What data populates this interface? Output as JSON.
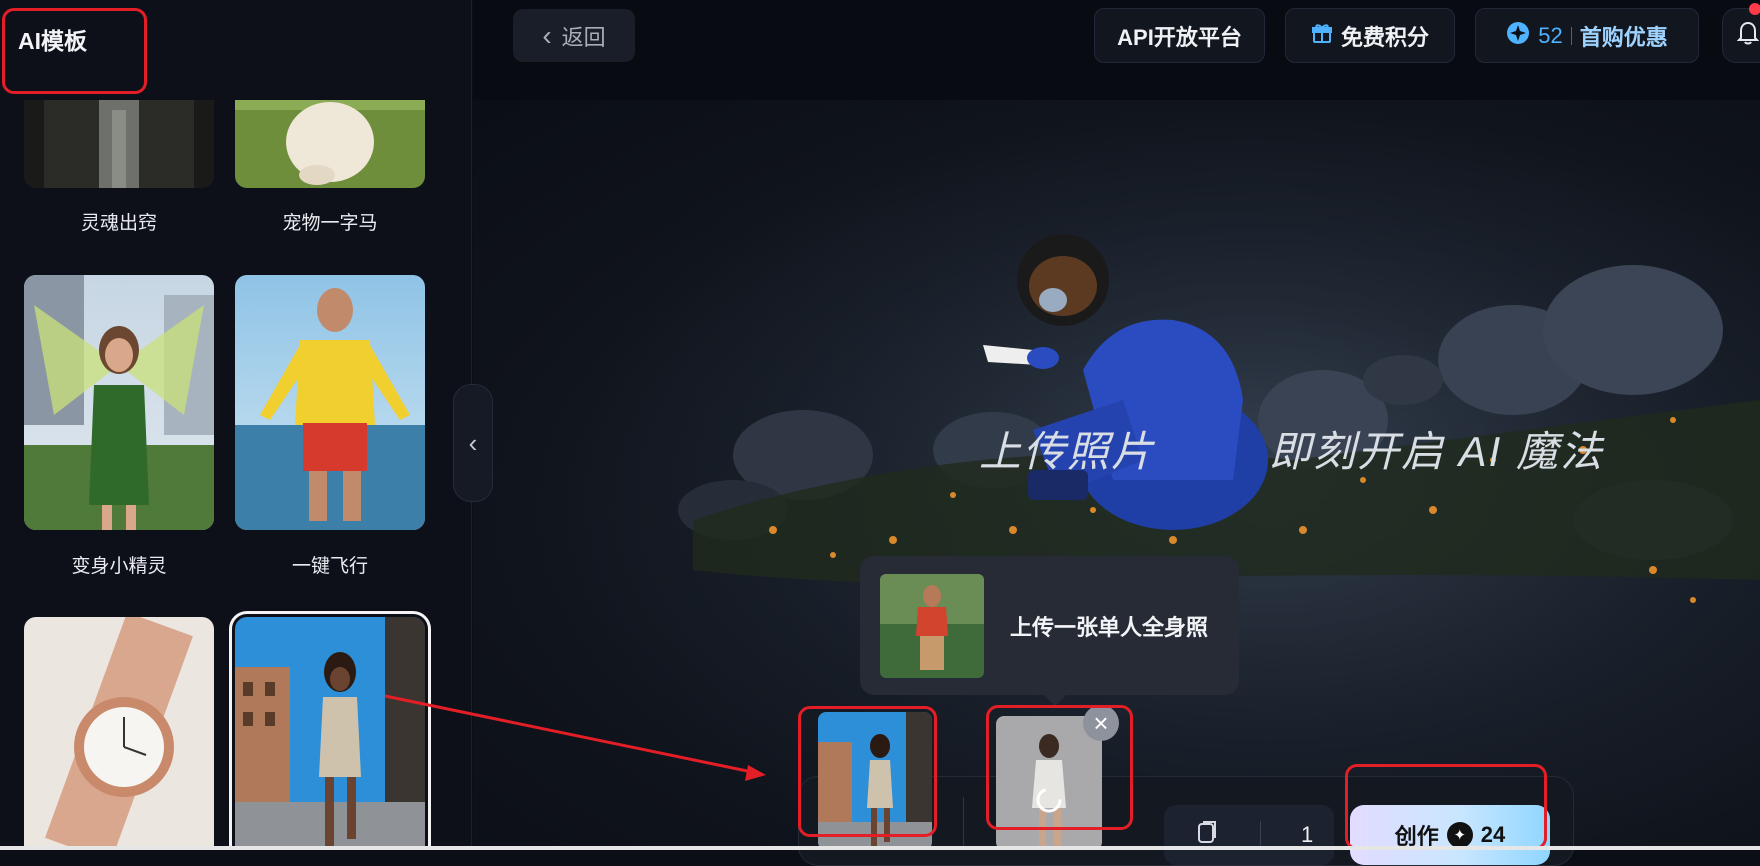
{
  "sidebar": {
    "title": "AI模板",
    "cards": [
      {
        "label": "灵魂出窍"
      },
      {
        "label": "宠物一字马"
      },
      {
        "label": "变身小精灵"
      },
      {
        "label": "一键飞行"
      },
      {
        "label": ""
      },
      {
        "label": ""
      }
    ]
  },
  "topbar": {
    "back_label": "返回",
    "api_label": "API开放平台",
    "free_points_label": "免费积分",
    "credits": "52",
    "promo_label": "首购优惠"
  },
  "hero": {
    "text_left": "上传照片",
    "text_right": "即刻开启 AI 魔法"
  },
  "tooltip": {
    "text": "上传一张单人全身照"
  },
  "toolbar": {
    "count": "1",
    "create_label": "创作",
    "create_cost": "24"
  },
  "icons": {
    "back": "chevron-left-icon",
    "gift": "gift-icon",
    "star": "star-icon",
    "bell": "bell-icon",
    "close": "close-icon",
    "collapse": "chevron-left-icon",
    "cards": "cards-icon"
  },
  "colors": {
    "accent_blue": "#4fb2ff",
    "annotation_red": "#e41e26"
  }
}
